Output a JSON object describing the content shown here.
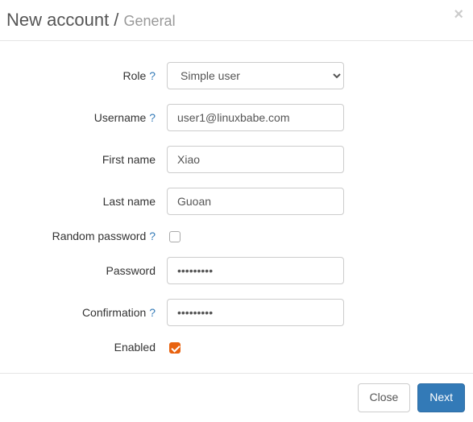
{
  "header": {
    "title_main": "New account",
    "title_sep": " / ",
    "title_sub": "General"
  },
  "form": {
    "role": {
      "label": "Role",
      "help": "?",
      "value": "Simple user"
    },
    "username": {
      "label": "Username",
      "help": "?",
      "value": "user1@linuxbabe.com"
    },
    "first_name": {
      "label": "First name",
      "value": "Xiao"
    },
    "last_name": {
      "label": "Last name",
      "value": "Guoan"
    },
    "random_password": {
      "label": "Random password",
      "help": "?",
      "checked": false
    },
    "password": {
      "label": "Password",
      "value": "•••••••••"
    },
    "confirmation": {
      "label": "Confirmation",
      "help": "?",
      "value": "•••••••••"
    },
    "enabled": {
      "label": "Enabled",
      "checked": true
    }
  },
  "footer": {
    "close": "Close",
    "next": "Next"
  }
}
